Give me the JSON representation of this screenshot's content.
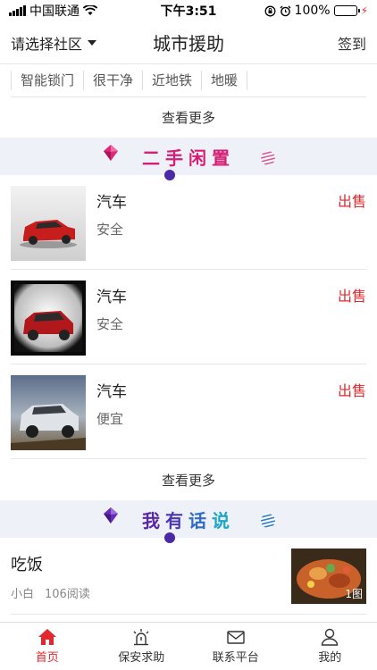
{
  "status_bar": {
    "carrier": "中国联通",
    "time": "下午3:51",
    "battery_percent": "100%",
    "battery_level": 1.0
  },
  "header": {
    "community_select": "请选择社区",
    "title": "城市援助",
    "signin": "签到"
  },
  "tags": [
    "智能锁门",
    "很干净",
    "近地铁",
    "地暖"
  ],
  "see_more_label": "查看更多",
  "secondhand": {
    "title": "二手闲置",
    "title_color": "#d61e74",
    "items": [
      {
        "name": "汽车",
        "tag": "安全",
        "status": "出售",
        "car_color": "#c81d1d"
      },
      {
        "name": "汽车",
        "tag": "安全",
        "status": "出售",
        "car_color": "#b0181c"
      },
      {
        "name": "汽车",
        "tag": "便宜",
        "status": "出售",
        "car_color": "#dfe3e8"
      }
    ]
  },
  "talk": {
    "title": "我有话说",
    "posts": [
      {
        "title": "吃饭",
        "author": "小白",
        "reads": "106阅读",
        "image_count": "1图"
      }
    ]
  },
  "tabbar": {
    "items": [
      {
        "label": "首页",
        "icon": "home-icon",
        "active": true
      },
      {
        "label": "保安求助",
        "icon": "alarm-icon",
        "active": false
      },
      {
        "label": "联系平台",
        "icon": "mail-icon",
        "active": false
      },
      {
        "label": "我的",
        "icon": "person-icon",
        "active": false
      }
    ]
  },
  "colors": {
    "accent": "#e0282e",
    "banner_bg": "#eef1f7"
  }
}
